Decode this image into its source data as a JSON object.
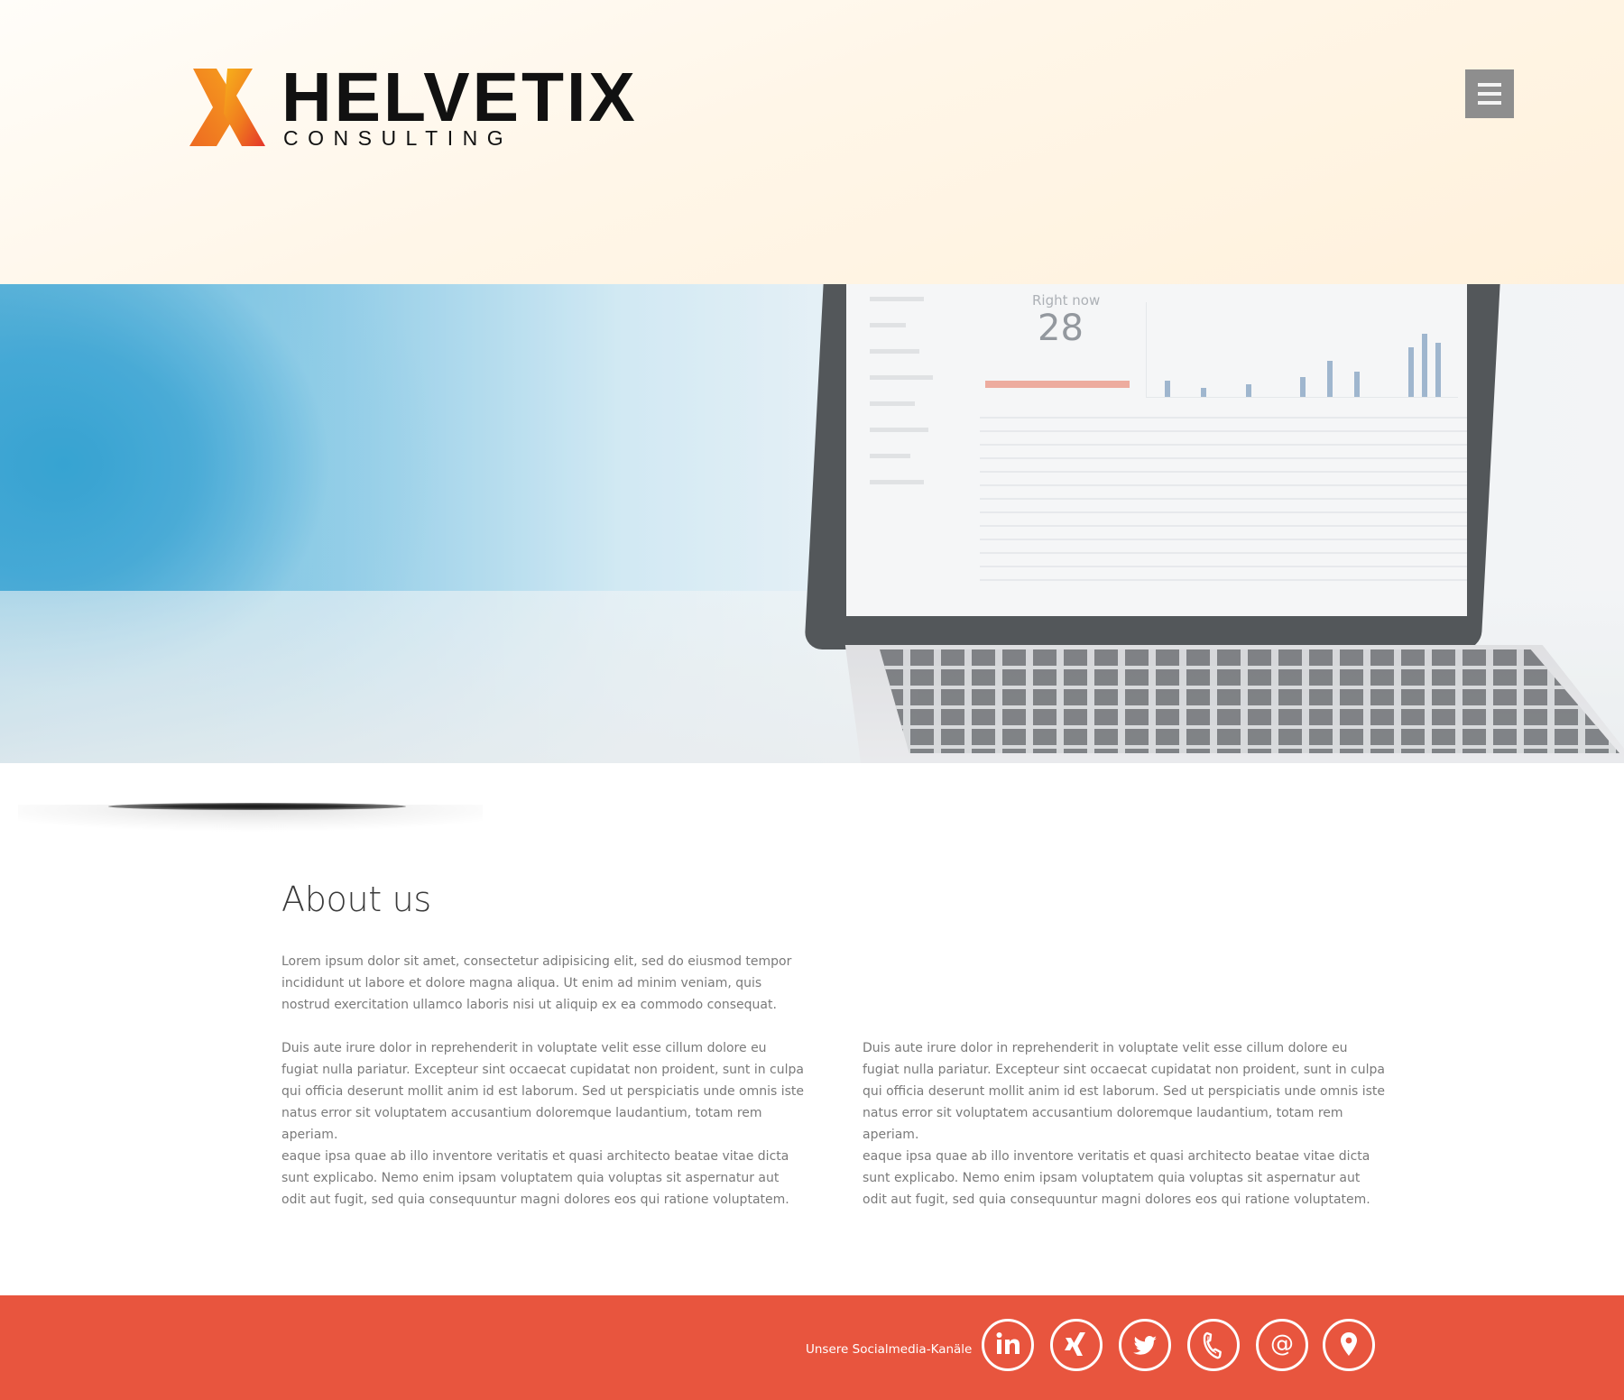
{
  "header": {
    "brand_name": "HELVETIX",
    "brand_subtitle": "CONSULTING",
    "menu_icon": "hamburger-icon"
  },
  "hero": {
    "screen_label": "Right now",
    "screen_value": "28"
  },
  "about": {
    "title": "About us",
    "paragraphs": [
      "Lorem ipsum dolor sit amet, consectetur adipisicing elit, sed do eiusmod tempor incididunt ut labore et dolore magna aliqua. Ut enim ad minim veniam, quis nostrud exercitation ullamco laboris nisi ut aliquip ex ea commodo consequat.",
      "Duis aute irure dolor in reprehenderit in voluptate velit esse cillum dolore eu fugiat nulla pariatur. Excepteur sint occaecat cupidatat non proident, sunt in culpa qui officia deserunt mollit anim id est laborum. Sed ut perspiciatis unde omnis iste natus error sit voluptatem accusantium doloremque laudantium, totam rem aperiam.",
      " eaque ipsa quae ab illo inventore veritatis et quasi architecto beatae vitae dicta sunt explicabo. Nemo enim ipsam voluptatem quia voluptas sit aspernatur aut odit aut fugit, sed quia consequuntur magni dolores eos qui ratione voluptatem.",
      "Duis aute irure dolor in reprehenderit in voluptate velit esse cillum dolore eu fugiat nulla pariatur. Excepteur sint occaecat cupidatat non proident, sunt in culpa qui officia deserunt mollit anim id est laborum. Sed ut perspiciatis unde omnis iste natus error sit voluptatem accusantium doloremque laudantium, totam rem aperiam.",
      " eaque ipsa quae ab illo inventore veritatis et quasi architecto beatae vitae dicta sunt explicabo. Nemo enim ipsam voluptatem quia voluptas sit aspernatur aut odit aut fugit, sed quia consequuntur magni dolores eos qui ratione voluptatem."
    ]
  },
  "footer": {
    "social_label": "Unsere Socialmedia-Kanäle",
    "icons": [
      "linkedin-icon",
      "xing-icon",
      "twitter-icon",
      "phone-icon",
      "email-icon",
      "location-icon"
    ]
  },
  "colors": {
    "footer_bg": "#e8553e",
    "menu_button_bg": "#8e8e8e",
    "logo_orange": "#f39a1e",
    "logo_red": "#e4342b"
  }
}
